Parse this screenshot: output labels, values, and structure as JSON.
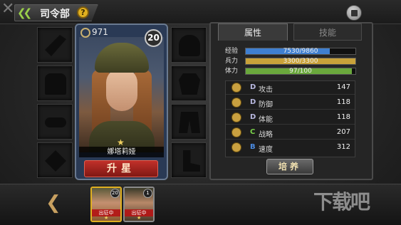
{
  "header": {
    "title": "司令部",
    "back_icon": "double-chevron-left-icon",
    "help_label": "?"
  },
  "card": {
    "power": "971",
    "level": "20",
    "name": "娜塔莉娅",
    "star": "★",
    "upgrade_label": "升星"
  },
  "tabs": [
    {
      "label": "属性",
      "active": true
    },
    {
      "label": "技能",
      "active": false
    }
  ],
  "bars": [
    {
      "label": "经验",
      "text": "7530/9860",
      "fraction": 0.764,
      "color": "#3f7fd0"
    },
    {
      "label": "兵力",
      "text": "3300/3300",
      "fraction": 1.0,
      "color": "#c9a23a"
    },
    {
      "label": "体力",
      "text": "97/100",
      "fraction": 0.97,
      "color": "#6aa83c"
    }
  ],
  "stats": [
    {
      "grade": "D",
      "grade_color": "#b8b8e0",
      "name": "攻击",
      "value": "147",
      "icon": "crosshair-icon"
    },
    {
      "grade": "D",
      "grade_color": "#b8b8e0",
      "name": "防御",
      "value": "118",
      "icon": "shield-icon"
    },
    {
      "grade": "D",
      "grade_color": "#b8b8e0",
      "name": "体能",
      "value": "118",
      "icon": "fist-icon"
    },
    {
      "grade": "C",
      "grade_color": "#7ad24a",
      "name": "战略",
      "value": "207",
      "icon": "strategy-icon"
    },
    {
      "grade": "B",
      "grade_color": "#4a8ae0",
      "name": "速度",
      "value": "312",
      "icon": "speed-icon"
    }
  ],
  "train_label": "培养",
  "roster": [
    {
      "level": "20",
      "tag": "出征中",
      "star": "★",
      "selected": true
    },
    {
      "level": "1",
      "tag": "出征中",
      "star": "★",
      "selected": false
    }
  ],
  "watermark": "下载吧"
}
